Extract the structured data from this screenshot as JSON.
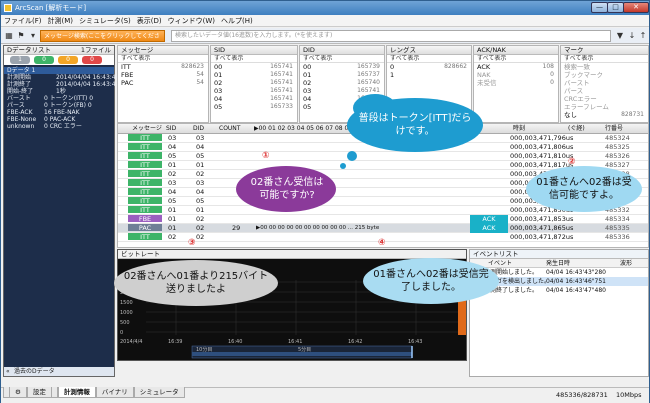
{
  "title": "ArcScan [解析モード]",
  "window_buttons": {
    "min": "—",
    "max": "□",
    "close": "✕"
  },
  "menu": [
    "ファイル(F)",
    "計測(M)",
    "シミュレータ(S)",
    "表示(D)",
    "ウィンドウ(W)",
    "ヘルプ(H)"
  ],
  "toolbar": {
    "message_search": "メッセージ検索(ここをクリックしてください)",
    "search_placeholder": "検索したいデータ値(16進数)を入力します。(*を使えます)"
  },
  "left": {
    "header": "Dデータリスト",
    "file_count": "1ファイル",
    "pills": [
      "1",
      "0",
      "0",
      "0"
    ],
    "pill_colors": [
      "#9aa3ad",
      "#3db468",
      "#f2a526",
      "#e04848"
    ],
    "rows": [
      {
        "k": "Dデータ 1",
        "v": ""
      },
      {
        "k": "計測開始",
        "v": "2014/04/04 16:43:46"
      },
      {
        "k": "計測終了",
        "v": "2014/04/04 16:43:47"
      },
      {
        "k": "開始-終了",
        "v": "1秒"
      },
      {
        "k": "バースト",
        "v": "0  トークン(ITT)  0"
      },
      {
        "k": "パース",
        "v": "0  トークン(FB)   0"
      },
      {
        "k": "FBE-ACK",
        "v": "16  FBE-NAK"
      },
      {
        "k": "FBE-None",
        "v": "0  PAC-ACK"
      },
      {
        "k": "unknown",
        "v": "0  CRC エラー"
      }
    ],
    "footer": "過去のDデータ"
  },
  "filters": {
    "message": {
      "header": "メッセージ",
      "all": "すべて表示",
      "items": [
        {
          "k": "ITT",
          "v": "828623"
        },
        {
          "k": "FBE",
          "v": "54"
        },
        {
          "k": "PAC",
          "v": "54"
        }
      ]
    },
    "sid": {
      "header": "SID",
      "all": "すべて表示",
      "items": [
        {
          "k": "00",
          "v": "165741"
        },
        {
          "k": "01",
          "v": "165741"
        },
        {
          "k": "02",
          "v": "165741"
        },
        {
          "k": "03",
          "v": "165741"
        },
        {
          "k": "04",
          "v": "165741"
        },
        {
          "k": "05",
          "v": "165733"
        }
      ]
    },
    "did": {
      "header": "DID",
      "all": "すべて表示",
      "items": [
        {
          "k": "00",
          "v": "165739"
        },
        {
          "k": "01",
          "v": "165737"
        },
        {
          "k": "02",
          "v": "165740"
        },
        {
          "k": "03",
          "v": "165741"
        },
        {
          "k": "04",
          "v": "165741"
        },
        {
          "k": "05",
          "v": "165741"
        }
      ]
    },
    "length": {
      "header": "レングス",
      "all": "すべて表示",
      "items": [
        {
          "k": "0",
          "v": "828662"
        },
        {
          "k": "1",
          "v": ""
        }
      ]
    },
    "acknak": {
      "header": "ACK/NAK",
      "all": "すべて表示",
      "items": [
        {
          "k": "ACK",
          "v": "108"
        },
        {
          "k": "NAK",
          "v": "0"
        },
        {
          "k": "未受信",
          "v": "0"
        }
      ]
    },
    "mark": {
      "header": "マーク",
      "all": "すべて表示",
      "items": [
        {
          "k": "検索一致",
          "v": ""
        },
        {
          "k": "ブックマーク",
          "v": ""
        },
        {
          "k": "バースト",
          "v": ""
        },
        {
          "k": "パース",
          "v": ""
        },
        {
          "k": "CRCエラー",
          "v": ""
        },
        {
          "k": "エラーフレーム",
          "v": ""
        },
        {
          "k": "なし",
          "v": "828731"
        }
      ]
    }
  },
  "grid": {
    "headers": [
      "メッセージ",
      "SID",
      "DID",
      "COUNT",
      "▶00 01 02 03 04 05 06 07 08 09",
      "時刻",
      "(ぐ経)",
      "行番号"
    ],
    "rows": [
      {
        "msg": "ITT",
        "sid": "03",
        "did": "03",
        "count": "",
        "data": "",
        "ack": "",
        "time": "000,003,471,796us",
        "line": "485324"
      },
      {
        "msg": "ITT",
        "sid": "04",
        "did": "04",
        "count": "",
        "data": "",
        "ack": "",
        "time": "000,003,471,806us",
        "line": "485325"
      },
      {
        "msg": "ITT",
        "sid": "05",
        "did": "05",
        "count": "",
        "data": "",
        "ack": "",
        "time": "000,003,471,810us",
        "line": "485326"
      },
      {
        "msg": "ITT",
        "sid": "01",
        "did": "01",
        "count": "",
        "data": "",
        "ack": "",
        "time": "000,003,471,817us",
        "line": "485327"
      },
      {
        "msg": "ITT",
        "sid": "02",
        "did": "02",
        "count": "",
        "data": "",
        "ack": "",
        "time": "000,003,471,821us",
        "line": "485328"
      },
      {
        "msg": "ITT",
        "sid": "03",
        "did": "03",
        "count": "",
        "data": "",
        "ack": "",
        "time": "000,003,471,828us",
        "line": "485329"
      },
      {
        "msg": "ITT",
        "sid": "04",
        "did": "04",
        "count": "",
        "data": "",
        "ack": "",
        "time": "000,003,471,835us",
        "line": "485330"
      },
      {
        "msg": "ITT",
        "sid": "05",
        "did": "05",
        "count": "",
        "data": "",
        "ack": "",
        "time": "000,003,471,845us",
        "line": "485331"
      },
      {
        "msg": "ITT",
        "sid": "01",
        "did": "01",
        "count": "",
        "data": "",
        "ack": "",
        "time": "000,003,471,850us",
        "line": "485332"
      },
      {
        "msg": "FBE",
        "sid": "01",
        "did": "02",
        "count": "",
        "data": "",
        "ack": "ACK",
        "time": "000,003,471,853us",
        "line": "485334"
      },
      {
        "msg": "PAC",
        "sid": "01",
        "did": "02",
        "count": "29",
        "data": "▶00 00 00 00 00 00 00 00 00 00 ... 215 byte",
        "ack": "ACK",
        "time": "000,003,471,865us",
        "line": "485335"
      },
      {
        "msg": "ITT",
        "sid": "02",
        "did": "02",
        "count": "",
        "data": "",
        "ack": "",
        "time": "000,003,471,872us",
        "line": "485336"
      }
    ]
  },
  "wave": {
    "header": "ビットレート",
    "y_ticks": [
      "2500",
      "2000",
      "1500",
      "1000",
      "500",
      "0"
    ],
    "x_ticks": [
      "2014/4/4",
      "16:39",
      "16:40",
      "16:41",
      "16:42",
      "16:43"
    ],
    "range_labels": [
      "10分目",
      "5分目"
    ]
  },
  "events": {
    "header": "イベントリスト",
    "cols": [
      "イベント",
      "発生日時",
      "波形"
    ],
    "rows": [
      {
        "n": "1",
        "e": "計測開始しました。",
        "t": "04/04 16:43'43\"280"
      },
      {
        "n": "2",
        "e": "トリガを検出しました。",
        "t": "04/04 16:43'46\"751"
      },
      {
        "n": "3",
        "e": "計測終了しました。",
        "t": "04/04 16:43'47\"480"
      }
    ]
  },
  "tabs": [
    "設定",
    "計測情報",
    "バイナリ",
    "シミュレータ"
  ],
  "status": {
    "pos": "485336/828731",
    "speed": "10Mbps"
  },
  "callouts": {
    "c1": "普段はトークン[ITT]だらけです。",
    "c2": "02番さん受信は可能ですか?",
    "c3": "01番さんへ02番は受信可能ですよ。",
    "c4": "02番さんへ01番より215バイト送りましたよ",
    "c5": "01番さんへ02番は受信完了しました。",
    "n1": "①",
    "n2": "②",
    "n3": "③",
    "n4": "④"
  }
}
